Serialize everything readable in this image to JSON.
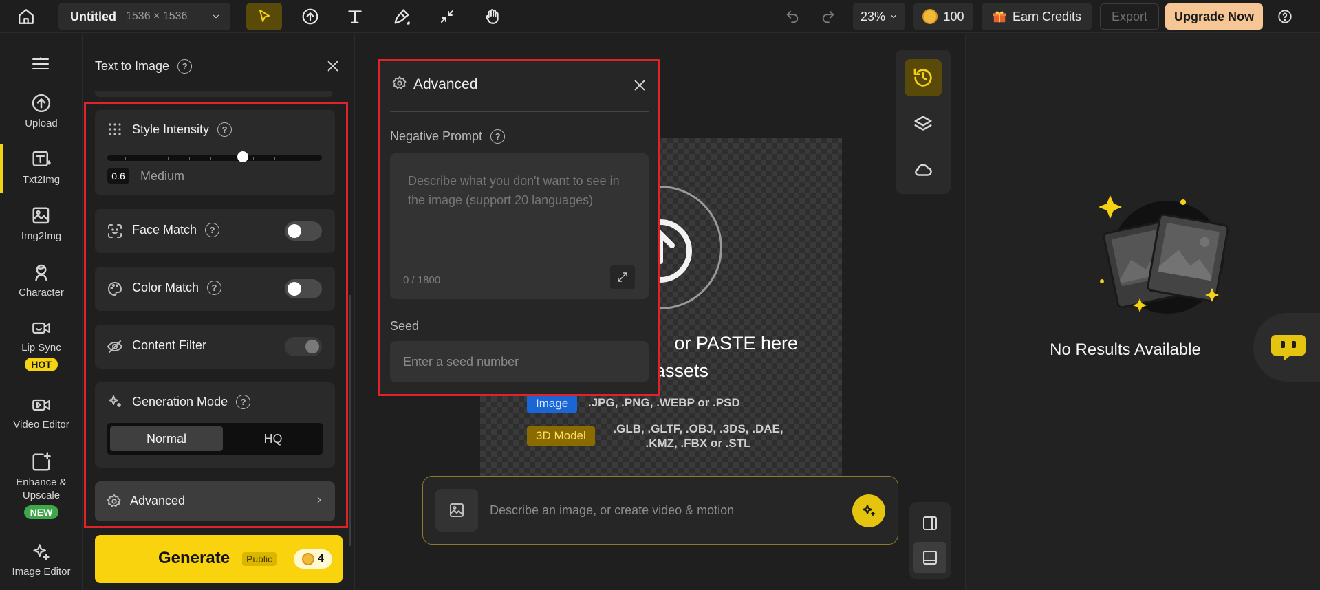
{
  "topbar": {
    "file_name": "Untitled",
    "file_size": "1536 × 1536",
    "zoom": "23%",
    "credits": "100",
    "earn_credits": "Earn Credits",
    "export": "Export",
    "upgrade": "Upgrade Now"
  },
  "leftnav": {
    "items": [
      {
        "label": "Upload"
      },
      {
        "label": "Txt2Img"
      },
      {
        "label": "Img2Img"
      },
      {
        "label": "Character"
      },
      {
        "label": "Lip Sync",
        "badge": "HOT"
      },
      {
        "label": "Video Editor"
      },
      {
        "label": "Enhance & Upscale",
        "badge": "NEW"
      },
      {
        "label": "Image Editor"
      }
    ]
  },
  "panel": {
    "title": "Text to Image",
    "style_intensity": {
      "label": "Style Intensity",
      "value": "0.6",
      "level": "Medium",
      "fraction": 0.6
    },
    "face_match": {
      "label": "Face Match",
      "on": false
    },
    "color_match": {
      "label": "Color Match",
      "on": false
    },
    "content_filter": {
      "label": "Content Filter",
      "on": true
    },
    "generation_mode": {
      "label": "Generation Mode",
      "options": [
        "Normal",
        "HQ"
      ],
      "selected": "Normal"
    },
    "advanced": {
      "label": "Advanced"
    },
    "generate": {
      "label": "Generate",
      "visibility": "Public",
      "cost": "4"
    }
  },
  "advanced_popup": {
    "title": "Advanced",
    "negative_prompt": {
      "label": "Negative Prompt",
      "placeholder": "Describe what you don't want to see in the image (support 20 languages)",
      "count": "0 / 1800"
    },
    "seed": {
      "label": "Seed",
      "placeholder": "Enter a seed number"
    }
  },
  "canvas": {
    "drop_line1": "or PASTE here",
    "drop_line2": "d assets",
    "image_tag": "Image",
    "image_formats": ".JPG, .PNG, .WEBP or .PSD",
    "model_tag": "3D Model",
    "model_formats": ".GLB, .GLTF, .OBJ, .3DS, .DAE, .KMZ, .FBX or .STL",
    "prompt_placeholder": "Describe an image, or create video & motion"
  },
  "results": {
    "empty_text": "No Results Available"
  },
  "colors": {
    "accent": "#f5d312",
    "highlight_box": "#e0222a",
    "upgrade": "#f6c694"
  }
}
